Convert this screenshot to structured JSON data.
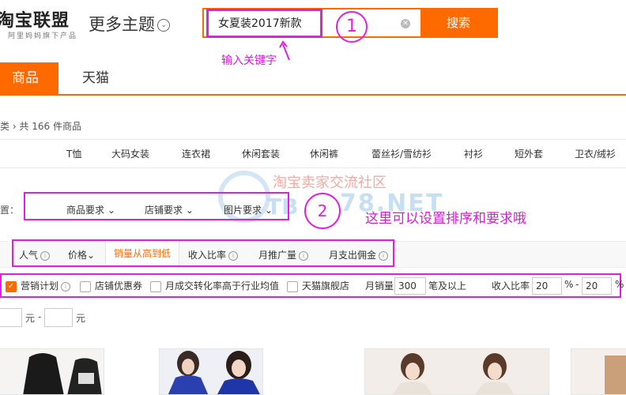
{
  "header": {
    "logo_main": "淘宝联盟",
    "logo_sub": "阿里妈妈旗下产品",
    "theme_label": "更多主题"
  },
  "search": {
    "value": "女夏装2017新款",
    "button": "搜索"
  },
  "annotations": {
    "step1": "1",
    "step1_hint": "输入关键字",
    "step2": "2",
    "step2_hint": "这里可以设置排序和要求哦"
  },
  "tabs": [
    {
      "label": "商品",
      "active": true
    },
    {
      "label": "天猫",
      "active": false
    }
  ],
  "breadcrumb": "类 › 共 166 件商品",
  "categories": [
    "T恤",
    "大码女装",
    "连衣裙",
    "休闲套装",
    "休闲裤",
    "蕾丝衫/雪纺衫",
    "衬衫",
    "短外套",
    "卫衣/绒衫"
  ],
  "watermark": {
    "text": "淘宝卖家交流社区",
    "tb": "TB",
    "net": "78.NET"
  },
  "sort_settings": {
    "label": "置：",
    "dropdowns": [
      "商品要求",
      "店铺要求",
      "图片要求"
    ]
  },
  "sort_bar": {
    "items": [
      "人气",
      "价格",
      "销量从高到低",
      "收入比率",
      "月推广量",
      "月支出佣金"
    ],
    "active_index": 2
  },
  "filters": {
    "marketing_plan": "营销计划",
    "store_coupon": "店铺优惠券",
    "conversion": "月成交转化率高于行业均值",
    "tmall_flagship": "天猫旗舰店",
    "monthly_sales_label": "月销量",
    "monthly_sales_value": "300",
    "monthly_sales_suffix": "笔及以上",
    "income_ratio_label": "收入比率",
    "income_min": "20",
    "income_max": "20",
    "percent": "%",
    "dash": "-"
  },
  "price_filter": {
    "unit": "元",
    "dash": "-"
  },
  "colors": {
    "accent": "#ff6a00",
    "annotation": "#e020e0"
  }
}
